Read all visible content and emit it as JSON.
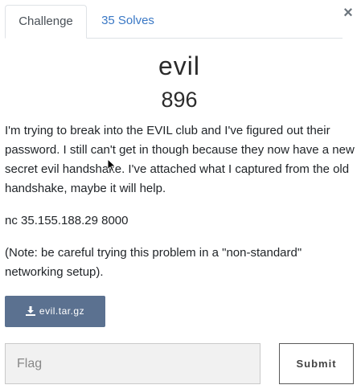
{
  "tabs": {
    "challenge": "Challenge",
    "solves": "35 Solves"
  },
  "close_symbol": "×",
  "challenge": {
    "name": "evil",
    "points": "896",
    "description_1": "I'm trying to break into the EVIL club and I've figured out their password. I still can't get in though because they now have a new secret evil handshake. I've attached what I captured from the old handshake, maybe it will help.",
    "description_2": "nc 35.155.188.29 8000",
    "description_3": "(Note: be careful trying this problem in a \"non-standard\" networking setup)."
  },
  "file": {
    "label": "evil.tar.gz",
    "icon": "download-icon"
  },
  "flag_form": {
    "placeholder": "Flag",
    "value": "",
    "submit_label": "Submit"
  },
  "colors": {
    "tab_link": "#3a78c5",
    "download_button": "#5b7190",
    "input_background": "#f1f1f1"
  }
}
